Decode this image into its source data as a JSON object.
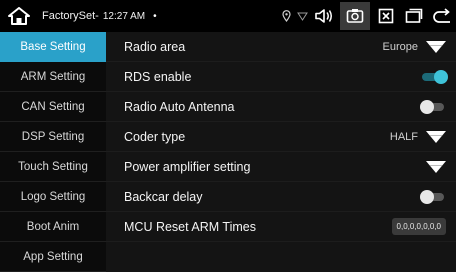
{
  "status": {
    "title": "FactorySet-",
    "time": "12:27 AM",
    "dot": "•"
  },
  "sidebar": {
    "items": [
      {
        "label": "Base Setting"
      },
      {
        "label": "ARM Setting"
      },
      {
        "label": "CAN Setting"
      },
      {
        "label": "DSP Setting"
      },
      {
        "label": "Touch Setting"
      },
      {
        "label": "Logo Setting"
      },
      {
        "label": "Boot Anim"
      },
      {
        "label": "App Setting"
      }
    ]
  },
  "settings": {
    "radio_area": {
      "label": "Radio area",
      "value": "Europe"
    },
    "rds_enable": {
      "label": "RDS enable",
      "enabled": true
    },
    "radio_auto_antenna": {
      "label": "Radio Auto Antenna",
      "enabled": false
    },
    "coder_type": {
      "label": "Coder type",
      "value": "HALF"
    },
    "power_amplifier": {
      "label": "Power amplifier setting"
    },
    "backcar_delay": {
      "label": "Backcar delay",
      "enabled": false
    },
    "mcu_reset": {
      "label": "MCU Reset ARM Times",
      "value": "0,0,0,0,0,0,0"
    }
  },
  "colors": {
    "accent": "#2aa1c9",
    "toggle_on": "#3fc3d9",
    "background": "#141414"
  }
}
